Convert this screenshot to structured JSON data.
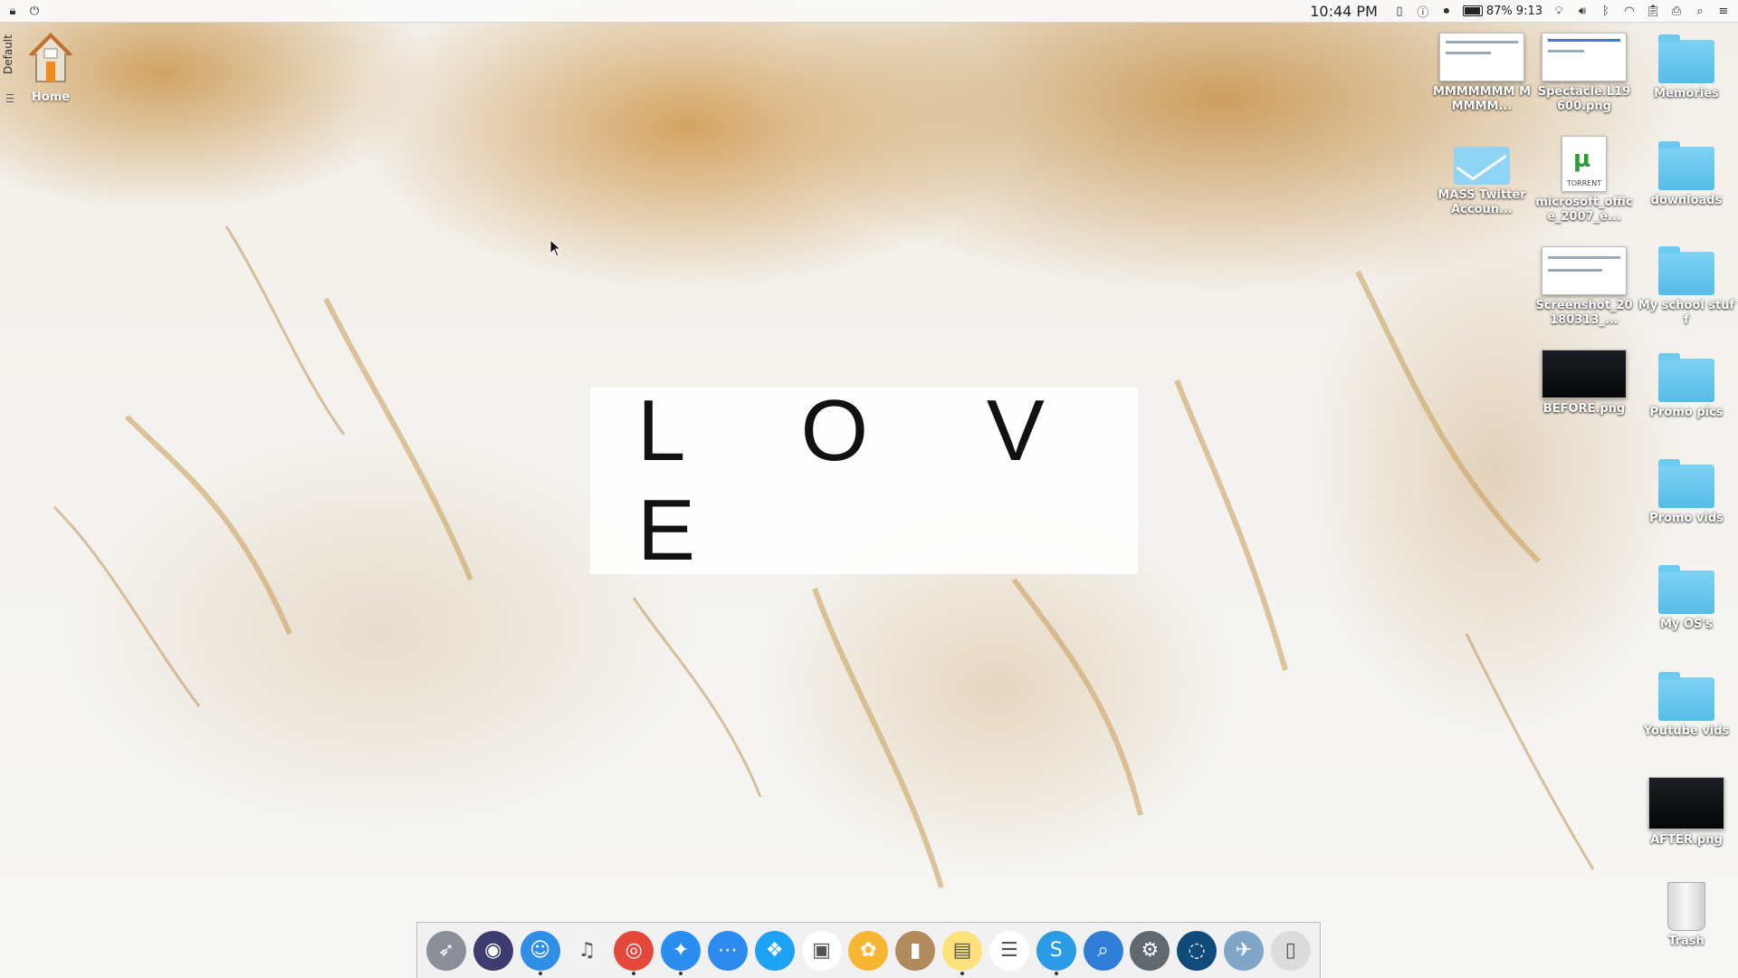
{
  "menubar": {
    "clock": "10:44 PM",
    "battery_percent": "87%",
    "battery_time": "9:13",
    "battery_level": 0.87,
    "icons": [
      "lock-icon",
      "power-icon",
      "phone-icon",
      "alert-icon",
      "record-icon",
      "battery-icon",
      "bulb-icon",
      "volume-icon",
      "bluetooth-icon",
      "wifi-icon",
      "clipboard-icon",
      "printer-icon",
      "search-icon",
      "menu-icon"
    ]
  },
  "side_panel": {
    "label": "Default"
  },
  "home": {
    "label": "Home"
  },
  "desktop_items": [
    {
      "label": "MMMMMMM MMMMM...",
      "kind": "screenshot"
    },
    {
      "label": "Spectacle.L19600.png",
      "kind": "screenshot"
    },
    {
      "label": "Memories",
      "kind": "folder"
    },
    {
      "label": "MASS Twitter Accoun...",
      "kind": "mail"
    },
    {
      "label": "microsoft_office_2007_e...",
      "kind": "torrent",
      "badge": "TORRENT"
    },
    {
      "label": "downloads",
      "kind": "folder"
    },
    {
      "label": "Screenshot_20180313_...",
      "kind": "screenshot"
    },
    {
      "label": "My school stuff",
      "kind": "folder"
    },
    {
      "label": "BEFORE.png",
      "kind": "dark-image"
    },
    {
      "label": "Promo pics",
      "kind": "folder"
    },
    {
      "label": "Promo vids",
      "kind": "folder"
    },
    {
      "label": "My OS's",
      "kind": "folder"
    },
    {
      "label": "Youtube vids",
      "kind": "folder"
    },
    {
      "label": "AFTER.png",
      "kind": "dark-image"
    },
    {
      "label": "Trash",
      "kind": "trash"
    }
  ],
  "wallpaper_text": "L O V E",
  "dock": [
    {
      "name": "launchpad-icon",
      "color": "#8a8f99",
      "glyph": "➶",
      "running": false
    },
    {
      "name": "siri-icon",
      "color": "#3c3c6e",
      "glyph": "◉",
      "running": false
    },
    {
      "name": "finder-icon",
      "color": "#2f8fe6",
      "glyph": "☺",
      "running": true
    },
    {
      "name": "music-icon",
      "color": "#f2f2f2",
      "glyph": "♫",
      "running": false
    },
    {
      "name": "chrome-icon",
      "color": "#e5473a",
      "glyph": "◎",
      "running": true
    },
    {
      "name": "safari-icon",
      "color": "#2a8ef0",
      "glyph": "✦",
      "running": true
    },
    {
      "name": "messages-icon",
      "color": "#2d8bf0",
      "glyph": "⋯",
      "running": false
    },
    {
      "name": "twitter-icon",
      "color": "#1da1f2",
      "glyph": "❖",
      "running": false
    },
    {
      "name": "image-viewer-icon",
      "color": "#ffffff",
      "glyph": "▣",
      "running": false
    },
    {
      "name": "photos-icon",
      "color": "#f7b733",
      "glyph": "✿",
      "running": false
    },
    {
      "name": "contacts-icon",
      "color": "#b08a5a",
      "glyph": "▮",
      "running": false
    },
    {
      "name": "notes-icon",
      "color": "#fbe27a",
      "glyph": "▤",
      "running": true
    },
    {
      "name": "reminders-icon",
      "color": "#ffffff",
      "glyph": "☰",
      "running": false
    },
    {
      "name": "skype-icon",
      "color": "#2a9be5",
      "glyph": "S",
      "running": true
    },
    {
      "name": "preview-icon",
      "color": "#2f7ed8",
      "glyph": "⌕",
      "running": false
    },
    {
      "name": "system-preferences-icon",
      "color": "#606870",
      "glyph": "⚙",
      "running": false
    },
    {
      "name": "network-icon",
      "color": "#0f4c7c",
      "glyph": "◌",
      "running": false
    },
    {
      "name": "image-capture-icon",
      "color": "#7fa6c8",
      "glyph": "✈",
      "running": false
    },
    {
      "name": "trash-icon",
      "color": "#dcdcdc",
      "glyph": "▯",
      "running": false
    }
  ]
}
